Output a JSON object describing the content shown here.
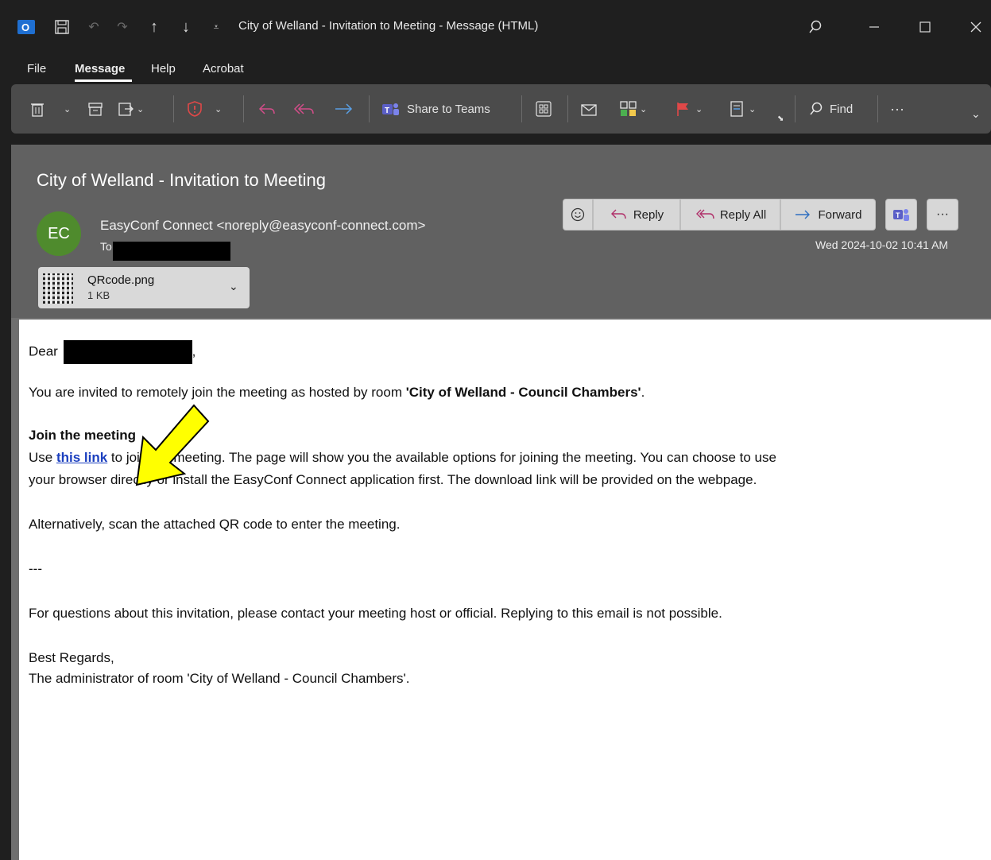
{
  "window": {
    "title": "City of Welland - Invitation to Meeting  -  Message (HTML)",
    "app_icon": "O"
  },
  "menu": {
    "items": [
      "File",
      "Message",
      "Help",
      "Acrobat"
    ]
  },
  "ribbon": {
    "share_label": "Share to Teams",
    "find_label": "Find",
    "more_label": "···"
  },
  "message": {
    "subject": "City of Welland - Invitation to Meeting",
    "avatar_initials": "EC",
    "sender": "EasyConf Connect <noreply@easyconf-connect.com>",
    "to_label": "To",
    "date": "Wed 2024-10-02 10:41 AM",
    "attachment": {
      "name": "QRcode.png",
      "size": "1 KB"
    },
    "actions": {
      "reply": "Reply",
      "reply_all": "Reply All",
      "forward": "Forward",
      "more": "···"
    }
  },
  "body": {
    "greeting": "Dear",
    "greeting_suffix": ",",
    "line1_prefix": "You are invited to remotely join the meeting as hosted by room ",
    "line1_room": "'City of Welland - Council Chambers'",
    "line1_suffix": ".",
    "join_heading": "Join the meeting",
    "use": "Use ",
    "link_text": "this link",
    "line2_rest": " to join the meeting. The page will show you the available options for joining the meeting. You can choose to use",
    "line3": "your browser directly or install the EasyConf Connect application first. The download link will be provided on the webpage.",
    "line4": "Alternatively, scan the attached QR code to enter the meeting.",
    "divider": "---",
    "line5": "For questions about this invitation, please contact your meeting host or official. Replying to this email is not possible.",
    "closing": "Best Regards,",
    "signature": "The administrator of room 'City of Welland - Council Chambers'."
  }
}
